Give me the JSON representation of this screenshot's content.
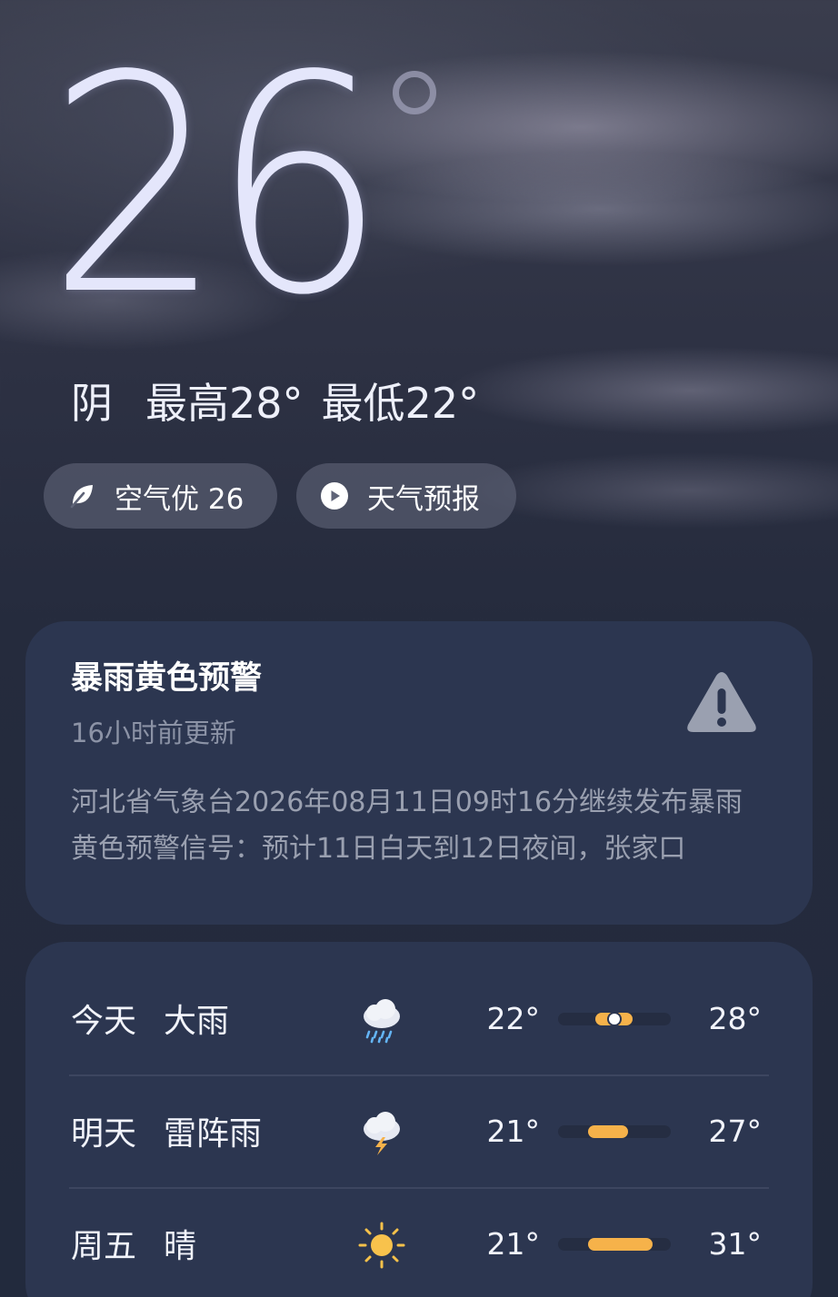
{
  "current": {
    "temperature": "26",
    "condition": "阴",
    "high": "最高28°",
    "low": "最低22°"
  },
  "chips": {
    "air_quality": "空气优 26",
    "forecast_video": "天气预报"
  },
  "alert": {
    "title": "暴雨黄色预警",
    "updated": "16小时前更新",
    "body": "河北省气象台2026年08月11日09时16分继续发布暴雨黄色预警信号：预计11日白天到12日夜间，张家口"
  },
  "forecast": [
    {
      "day": "今天",
      "condition": "大雨",
      "icon": "heavy-rain-icon",
      "low": "22°",
      "high": "28°",
      "range_start": 0.33,
      "range_end": 0.66,
      "current_marker": 0.5
    },
    {
      "day": "明天",
      "condition": "雷阵雨",
      "icon": "thunderstorm-icon",
      "low": "21°",
      "high": "27°",
      "range_start": 0.27,
      "range_end": 0.62
    },
    {
      "day": "周五",
      "condition": "晴",
      "icon": "sunny-icon",
      "low": "21°",
      "high": "31°",
      "range_start": 0.27,
      "range_end": 0.84
    }
  ],
  "colors": {
    "background": "#252b3d",
    "card": "#2c3650",
    "range_bar": "#f6b24a",
    "alert_icon": "#9aa0b0"
  }
}
